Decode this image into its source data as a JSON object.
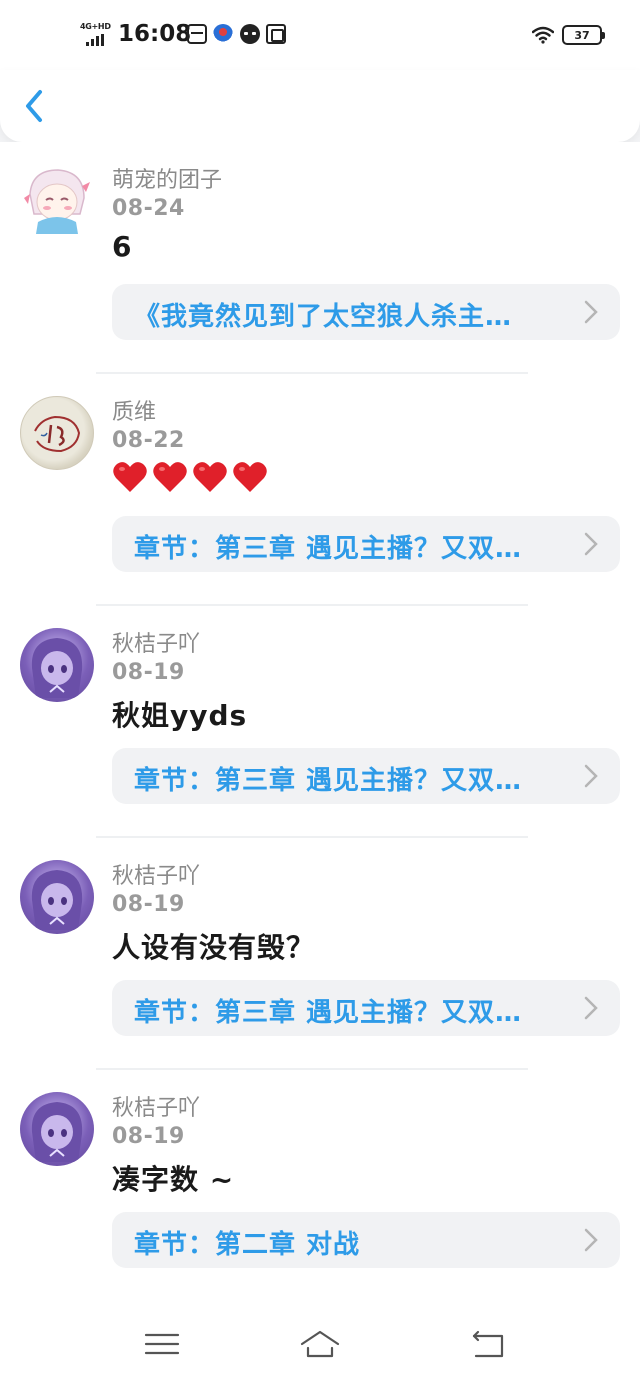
{
  "status_bar": {
    "network": "4G+HD",
    "time": "16:08",
    "battery": "37",
    "icons": [
      "calendar-icon",
      "app-icon",
      "mascot-icon",
      "translate-icon",
      "wifi-icon",
      "battery-icon"
    ]
  },
  "header": {
    "back_icon": "chevron-left-icon"
  },
  "comments": [
    {
      "user": "萌宠的团子",
      "date": "08-24",
      "text": "6",
      "link": "《我竟然见到了太空狼人杀主…",
      "avatar": "anime-girl-pink"
    },
    {
      "user": "质维",
      "date": "08-22",
      "text": "",
      "hearts": 4,
      "link": "章节：第三章 遇见主播？又双…",
      "avatar": "hand-drawn"
    },
    {
      "user": "秋桔子吖",
      "date": "08-19",
      "text": "秋姐yyds",
      "link": "章节：第三章 遇见主播？又双…",
      "avatar": "purple-anime-girl"
    },
    {
      "user": "秋桔子吖",
      "date": "08-19",
      "text": "人设有没有毁？",
      "link": "章节：第三章 遇见主播？又双…",
      "avatar": "purple-anime-girl"
    },
    {
      "user": "秋桔子吖",
      "date": "08-19",
      "text": "凑字数 ~",
      "link": "章节：第二章 对战",
      "avatar": "purple-anime-girl"
    }
  ],
  "colors": {
    "link": "#2e9be8",
    "back": "#2e9be8",
    "heart": "#e0202a",
    "card": "#f1f2f4"
  },
  "nav_bar": {
    "icons": [
      "menu-icon",
      "home-icon",
      "back-icon"
    ]
  }
}
